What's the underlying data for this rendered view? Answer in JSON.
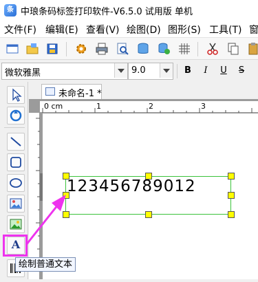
{
  "app": {
    "title": "中琅条码标签打印软件-V6.5.0 试用版 单机"
  },
  "menu": {
    "items": [
      "文件(F)",
      "编辑(E)",
      "查看(V)",
      "绘图(D)",
      "图形(S)",
      "工具(T)",
      "窗"
    ]
  },
  "toolbar": {
    "icons": [
      "new-icon",
      "open-icon",
      "save-icon",
      "settings-icon",
      "print-icon",
      "print-preview-icon",
      "database-icon",
      "data-source-icon",
      "grid-icon",
      "cut-icon",
      "copy-icon"
    ]
  },
  "format_bar": {
    "font_name": "微软雅黑",
    "font_size": "9.0",
    "bold_label": "B",
    "italic_label": "I",
    "underline_label": "U",
    "strike_label": "S"
  },
  "document": {
    "tab_label": "未命名-1 *"
  },
  "ruler": {
    "origin_label": "0 cm",
    "marks": [
      "1",
      "2",
      "3"
    ]
  },
  "canvas": {
    "text_object_value": "123456789012"
  },
  "palette": {
    "draw_text_glyph": "A"
  },
  "tooltip": {
    "text": "绘制普通文本"
  },
  "colors": {
    "selection_border": "#3ac23a",
    "handle_fill": "#ffff00",
    "annotation_pink": "#ee33ee"
  }
}
